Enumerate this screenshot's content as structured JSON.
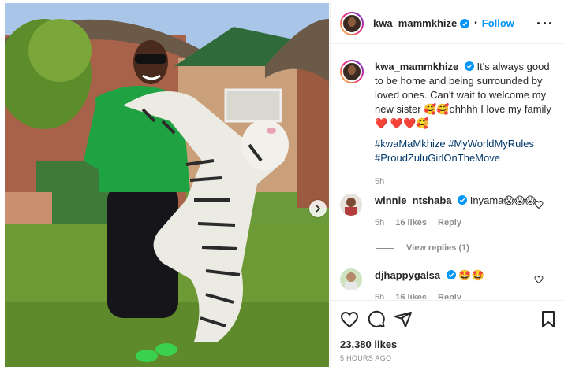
{
  "post": {
    "username": "kwa_mammkhize",
    "follow_label": "Follow",
    "dot": "•",
    "caption_text": "It's always good to be home and being surrounded by loved ones. Can't wait to welcome my new sister 🥰🥰ohhhh I love my family ❤️ ❤️❤️🥰",
    "hashtags": "#kwaMaMkhize #MyWorldMyRules #ProudZuluGirlOnTheMove",
    "caption_time": "5h",
    "likes": "23,380 likes",
    "posted": "5 HOURS AGO"
  },
  "comments": [
    {
      "username": "winnie_ntshaba",
      "text": "Inyama😱😱😱",
      "time": "5h",
      "likes": "16 likes",
      "reply": "Reply"
    },
    {
      "username": "djhappygalsa",
      "text": "🤩🤩",
      "time": "5h",
      "likes": "16 likes",
      "reply": "Reply"
    }
  ],
  "view_replies": "View replies (1)",
  "icons": [
    "more-options-icon",
    "heart-icon",
    "comment-icon",
    "share-icon",
    "bookmark-icon",
    "next-arrow-icon",
    "verified-icon"
  ],
  "colors": {
    "link": "#0095f6",
    "hashtag": "#00376b",
    "muted": "#8e8e8e",
    "text": "#262626"
  }
}
